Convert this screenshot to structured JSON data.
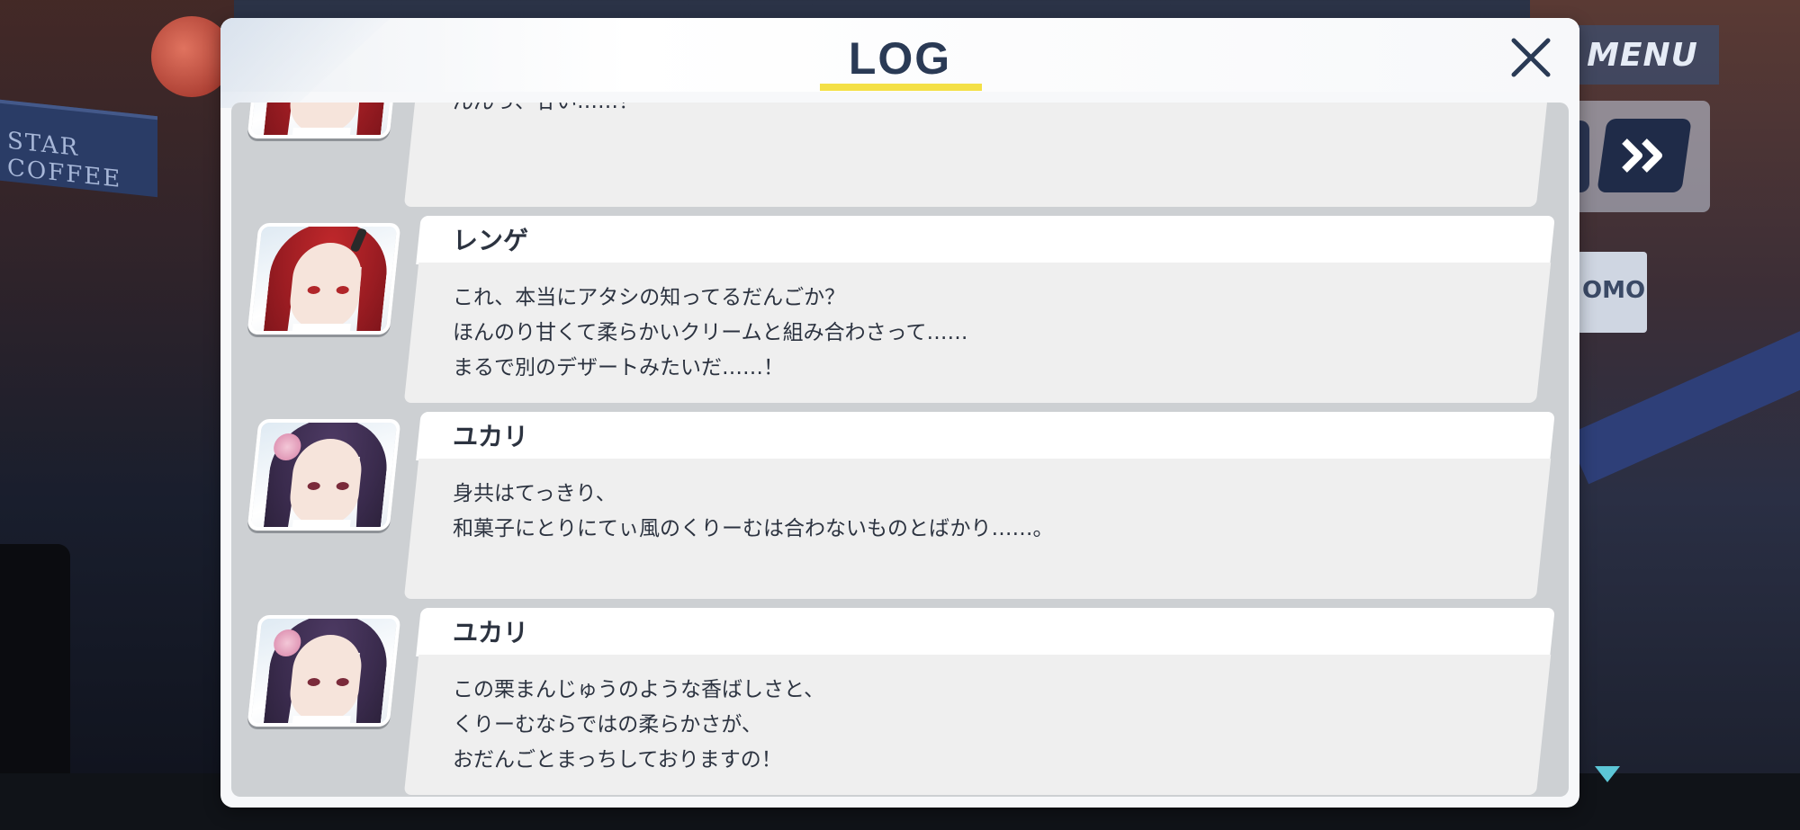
{
  "background": {
    "left_sign_text": "STAR COFFEE",
    "right_sign_text": "OMO"
  },
  "hud": {
    "menu_label": "MENU",
    "fast_forward_icon": "double-chevron-right-icon",
    "scroll_indicator_icon": "triangle-down-icon"
  },
  "log": {
    "title": "LOG",
    "close_icon": "close-icon",
    "accent_color": "#f4e046",
    "entries": [
      {
        "speaker": "",
        "character": "renge",
        "lines": [
          "んんっ、甘い……！"
        ]
      },
      {
        "speaker": "レンゲ",
        "character": "renge",
        "lines": [
          "これ、本当にアタシの知ってるだんごか？",
          "ほんのり甘くて柔らかいクリームと組み合わさって……",
          "まるで別のデザートみたいだ……！"
        ]
      },
      {
        "speaker": "ユカリ",
        "character": "yukari",
        "lines": [
          "身共はてっきり、",
          "和菓子にとりにてぃ風のくりーむは合わないものとばかり……。"
        ]
      },
      {
        "speaker": "ユカリ",
        "character": "yukari",
        "lines": [
          "この栗まんじゅうのような香ばしさと、",
          "くりーむならではの柔らかさが、",
          "おだんごとまっちしておりますの！"
        ]
      }
    ]
  }
}
